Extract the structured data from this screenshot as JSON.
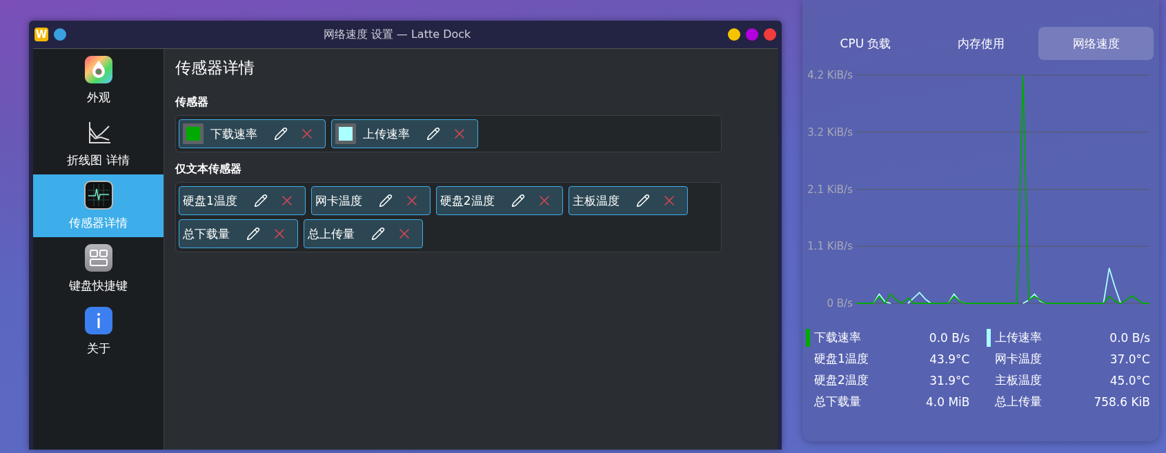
{
  "window": {
    "title": "网络速度 设置 — Latte Dock",
    "app_icon_letter": "W"
  },
  "sidebar": {
    "items": [
      {
        "label": "外观",
        "kind": "appearance",
        "selected": false
      },
      {
        "label": "折线图 详情",
        "kind": "chart",
        "selected": false
      },
      {
        "label": "传感器详情",
        "kind": "sensor",
        "selected": true
      },
      {
        "label": "键盘快捷键",
        "kind": "keyboard",
        "selected": false
      },
      {
        "label": "关于",
        "kind": "about",
        "selected": false
      }
    ]
  },
  "content": {
    "heading": "传感器详情",
    "sections": [
      {
        "title": "传感器",
        "kind": "chart",
        "sensors": [
          {
            "label": "下载速率",
            "color": "#00aa00"
          },
          {
            "label": "上传速率",
            "color": "#aaffff"
          }
        ]
      },
      {
        "title": "仅文本传感器",
        "kind": "text",
        "sensors": [
          {
            "label": "硬盘1温度"
          },
          {
            "label": "网卡温度"
          },
          {
            "label": "硬盘2温度"
          },
          {
            "label": "主板温度"
          },
          {
            "label": "总下载量"
          },
          {
            "label": "总上传量"
          }
        ]
      }
    ]
  },
  "panel": {
    "tabs": [
      {
        "label": "CPU 负载",
        "selected": false
      },
      {
        "label": "内存使用",
        "selected": false
      },
      {
        "label": "网络速度",
        "selected": true
      }
    ],
    "chart_data": {
      "type": "line",
      "grid": true,
      "ylim": [
        0,
        4.2
      ],
      "yticks": [
        {
          "value": 0,
          "label": "0 B/s"
        },
        {
          "value": 1.05,
          "label": "1.1 KiB/s"
        },
        {
          "value": 2.1,
          "label": "2.1 KiB/s"
        },
        {
          "value": 3.15,
          "label": "3.2 KiB/s"
        },
        {
          "value": 4.2,
          "label": "4.2 KiB/s"
        }
      ],
      "series": [
        {
          "name": "下载速率",
          "color": "#00aa00",
          "values": [
            0,
            0,
            0,
            0,
            0.13,
            0,
            0.17,
            0.06,
            0,
            0.1,
            0,
            0,
            0,
            0,
            0,
            0,
            0,
            0.13,
            0.04,
            0,
            0,
            0,
            0,
            0,
            0,
            0,
            0,
            0,
            0,
            4.2,
            0.06,
            0.13,
            0.06,
            0,
            0,
            0,
            0,
            0,
            0,
            0,
            0,
            0,
            0,
            0,
            0.13,
            0.04,
            0,
            0.06,
            0.14,
            0.06,
            0,
            0
          ]
        },
        {
          "name": "上传速率",
          "color": "#aaffff",
          "values": [
            null,
            null,
            null,
            0,
            0.17,
            0.03,
            0,
            null,
            null,
            0,
            0.1,
            0.2,
            0.08,
            0,
            null,
            null,
            0,
            0.17,
            0.04,
            0,
            null,
            null,
            null,
            null,
            null,
            null,
            null,
            null,
            null,
            0,
            0.06,
            0.17,
            0.04,
            0,
            null,
            null,
            null,
            null,
            null,
            null,
            null,
            null,
            null,
            0,
            0.65,
            0.3,
            0,
            null,
            null,
            null,
            null,
            null
          ]
        }
      ]
    },
    "legend": [
      {
        "kind": "series",
        "value": "0.0 B/s"
      },
      {
        "kind": "series",
        "value": "0.0 B/s"
      },
      {
        "label": "硬盘1温度",
        "value": "43.9°C"
      },
      {
        "label": "网卡温度",
        "value": "37.0°C"
      },
      {
        "label": "硬盘2温度",
        "value": "31.9°C"
      },
      {
        "label": "主板温度",
        "value": "45.0°C"
      },
      {
        "label": "总下载量",
        "value": "4.0 MiB"
      },
      {
        "label": "总上传量",
        "value": "758.6 KiB"
      }
    ]
  }
}
